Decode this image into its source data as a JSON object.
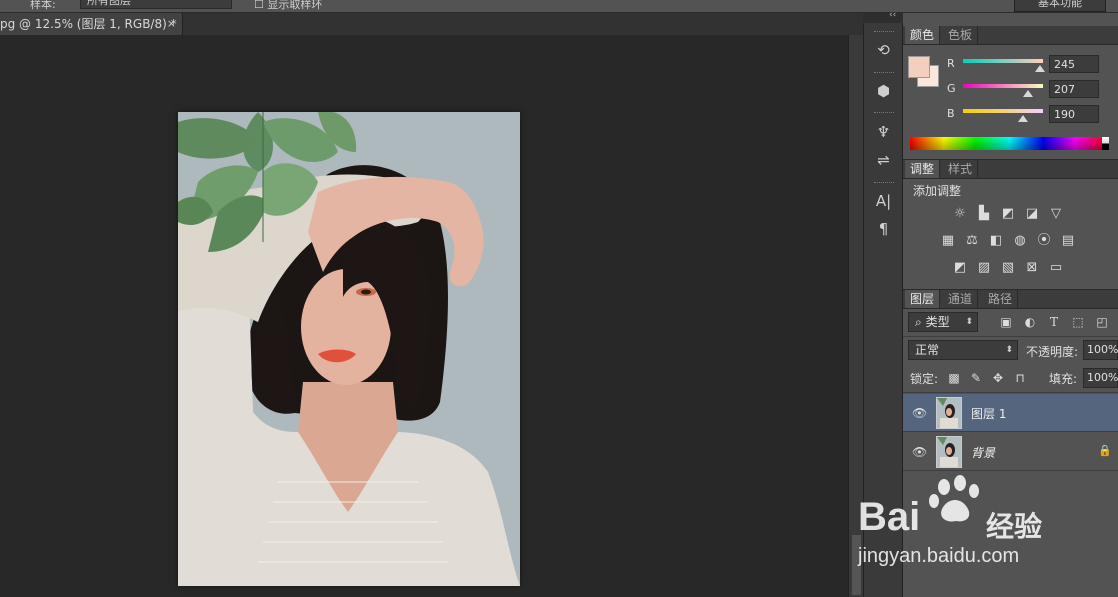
{
  "options_bar": {
    "sample_label": "样本:",
    "sample_value": "所有图层",
    "checkbox_label": "显示取样环",
    "workspace": "基本功能"
  },
  "document": {
    "tab_title": "pg @ 12.5% (图层 1, RGB/8) *",
    "close_glyph": "×"
  },
  "tools": {
    "collapse_glyph": "‹‹",
    "items": [
      {
        "icon": "history-brush-icon",
        "glyph": "⟲"
      },
      {
        "icon": "3d-cube-icon",
        "glyph": "⬢"
      },
      {
        "icon": "brush-preset-icon",
        "glyph": "♆"
      },
      {
        "icon": "tool-preset-icon",
        "glyph": "⇌"
      },
      {
        "icon": "character-icon",
        "glyph": "A|"
      },
      {
        "icon": "paragraph-icon",
        "glyph": "¶"
      }
    ]
  },
  "color_panel": {
    "tabs": [
      "颜色",
      "色板"
    ],
    "foreground": "#f5cfbe",
    "background": "#fbe6dc",
    "channels": [
      {
        "label": "R",
        "value": "245",
        "fraction": 0.96
      },
      {
        "label": "G",
        "value": "207",
        "fraction": 0.81
      },
      {
        "label": "B",
        "value": "190",
        "fraction": 0.745
      }
    ]
  },
  "adjustments_panel": {
    "tabs": [
      "调整",
      "样式"
    ],
    "title": "添加调整",
    "icons": [
      [
        "brightness-icon",
        "levels-icon",
        "curves-icon",
        "exposure-icon",
        "vibrance-icon"
      ],
      [
        "hue-saturation-icon",
        "color-balance-icon",
        "black-white-icon",
        "photo-filter-icon",
        "channel-mixer-icon",
        "color-lookup-icon"
      ],
      [
        "invert-icon",
        "posterize-icon",
        "threshold-icon",
        "selective-color-icon",
        "gradient-map-icon"
      ]
    ]
  },
  "layers_panel": {
    "tabs": [
      "图层",
      "通道",
      "路径"
    ],
    "filter": {
      "glyph": "⌕",
      "label": "类型"
    },
    "blend_mode": "正常",
    "opacity_label": "不透明度:",
    "opacity_value": "100%",
    "lock_label": "锁定:",
    "fill_label": "填充:",
    "fill_value": "100%",
    "layers": [
      {
        "name": "图层 1",
        "selected": true,
        "locked": false
      },
      {
        "name": "背景",
        "selected": false,
        "locked": true
      }
    ]
  },
  "glyphs": {
    "eye": "👁",
    "lock": "🔒",
    "arrow": "⬍"
  },
  "watermark": {
    "brand": "Bai",
    "brand2": "经验",
    "url": "jingyan.baidu.com"
  }
}
